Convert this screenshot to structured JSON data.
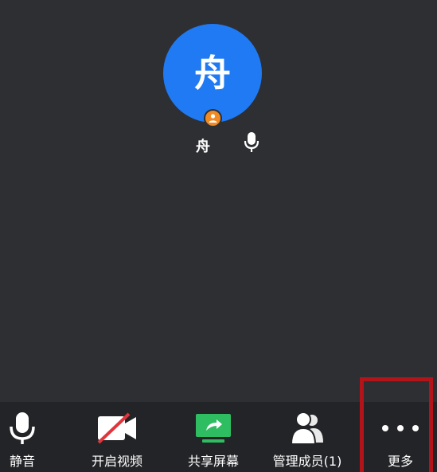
{
  "participant": {
    "avatar_char": "舟",
    "name": "舟",
    "avatar_color": "#1f7af3",
    "badge_icon": "host-user-icon",
    "mic_icon": "microphone-icon"
  },
  "toolbar": {
    "items": [
      {
        "label": "静音",
        "icon": "microphone-icon"
      },
      {
        "label": "开启视频",
        "icon": "video-off-icon"
      },
      {
        "label": "共享屏幕",
        "icon": "share-screen-icon"
      },
      {
        "label": "管理成员(1)",
        "icon": "members-icon"
      },
      {
        "label": "更多",
        "icon": "more-dots-icon"
      }
    ]
  },
  "highlight_color": "#b3141a"
}
